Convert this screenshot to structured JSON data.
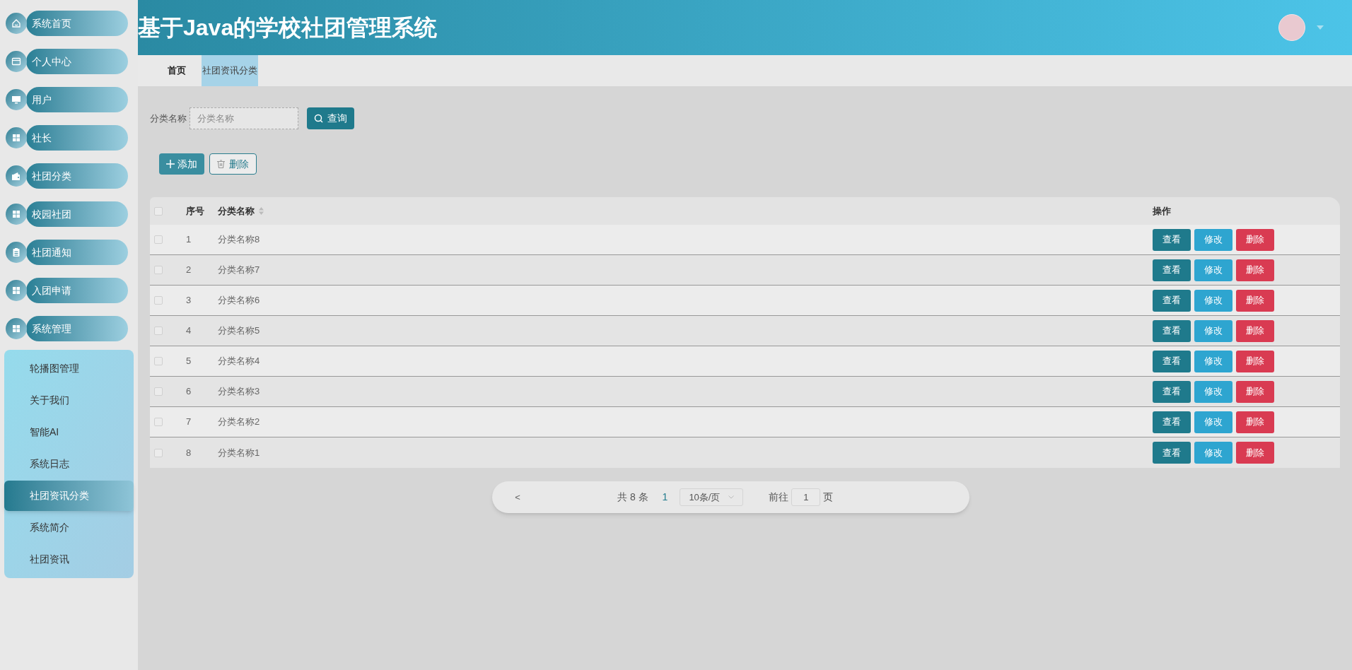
{
  "sidebar": {
    "items": [
      {
        "label": "系统首页",
        "kind": "home"
      },
      {
        "label": "个人中心",
        "kind": "card"
      },
      {
        "label": "用户",
        "kind": "monitor"
      },
      {
        "label": "社长",
        "kind": "grid"
      },
      {
        "label": "社团分类",
        "kind": "wallet"
      },
      {
        "label": "校园社团",
        "kind": "grid"
      },
      {
        "label": "社团通知",
        "kind": "clipboard"
      },
      {
        "label": "入团申请",
        "kind": "grid"
      },
      {
        "label": "系统管理",
        "kind": "grid"
      }
    ],
    "submenu": [
      {
        "label": "轮播图管理",
        "selected": false
      },
      {
        "label": "关于我们",
        "selected": false
      },
      {
        "label": "智能AI",
        "selected": false
      },
      {
        "label": "系统日志",
        "selected": false
      },
      {
        "label": "社团资讯分类",
        "selected": true
      },
      {
        "label": "系统简介",
        "selected": false
      },
      {
        "label": "社团资讯",
        "selected": false
      }
    ]
  },
  "header": {
    "title": "基于Java的学校社团管理系统"
  },
  "tabs": [
    {
      "label": "首页",
      "selected": false
    },
    {
      "label": "社团资讯分类",
      "selected": true
    }
  ],
  "search": {
    "label": "分类名称",
    "placeholder": "分类名称",
    "button": "查询"
  },
  "toolbar": {
    "add": "添加",
    "delete": "删除"
  },
  "table": {
    "select_all_checked": false,
    "columns": [
      "序号",
      "分类名称",
      "操作"
    ],
    "rows": [
      {
        "index": "1",
        "name": "分类名称8",
        "checked": false,
        "actions": [
          "查看",
          "修改",
          "删除"
        ]
      },
      {
        "index": "2",
        "name": "分类名称7",
        "checked": false,
        "actions": [
          "查看",
          "修改",
          "删除"
        ]
      },
      {
        "index": "3",
        "name": "分类名称6",
        "checked": false,
        "actions": [
          "查看",
          "修改",
          "删除"
        ]
      },
      {
        "index": "4",
        "name": "分类名称5",
        "checked": false,
        "actions": [
          "查看",
          "修改",
          "删除"
        ]
      },
      {
        "index": "5",
        "name": "分类名称4",
        "checked": false,
        "actions": [
          "查看",
          "修改",
          "删除"
        ]
      },
      {
        "index": "6",
        "name": "分类名称3",
        "checked": false,
        "actions": [
          "查看",
          "修改",
          "删除"
        ]
      },
      {
        "index": "7",
        "name": "分类名称2",
        "checked": false,
        "actions": [
          "查看",
          "修改",
          "删除"
        ]
      },
      {
        "index": "8",
        "name": "分类名称1",
        "checked": false,
        "actions": [
          "查看",
          "修改",
          "删除"
        ]
      }
    ]
  },
  "pagination": {
    "prev": "<",
    "total": "共 8 条",
    "current_page": "1",
    "page_size": "10条/页",
    "goto_label": "前往",
    "goto_value": "1",
    "page_unit": "页"
  }
}
